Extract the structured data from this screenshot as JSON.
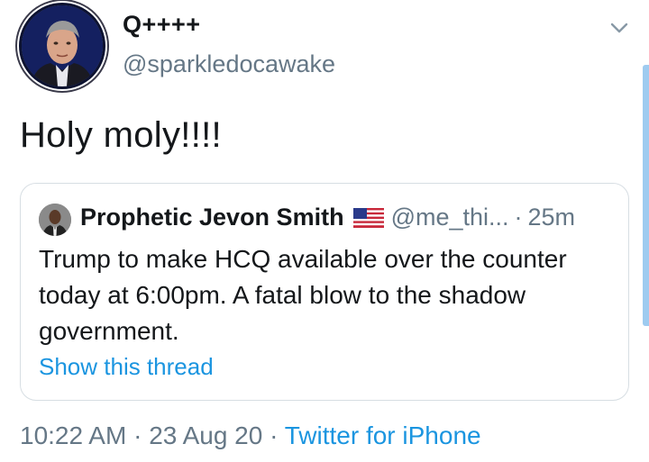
{
  "author": {
    "display_name": "Q++++",
    "handle": "@sparkledocawake"
  },
  "tweet": {
    "text": "Holy moly!!!!"
  },
  "quoted_tweet": {
    "display_name": "Prophetic Jevon Smith",
    "handle": "@me_thi...",
    "separator": "·",
    "time": "25m",
    "body": "Trump to make HCQ available over the counter today at 6:00pm. A fatal blow to the shadow government.",
    "show_thread": "Show this thread"
  },
  "meta": {
    "time": "10:22 AM",
    "sep1": " · ",
    "date": "23 Aug 20",
    "sep2": " · ",
    "source": "Twitter for iPhone"
  },
  "colors": {
    "accent": "#1b95e0",
    "secondary_text": "#657786",
    "border": "#d7dee3"
  },
  "icons": {
    "menu": "chevron-down-icon",
    "flag": "us-flag-icon"
  }
}
